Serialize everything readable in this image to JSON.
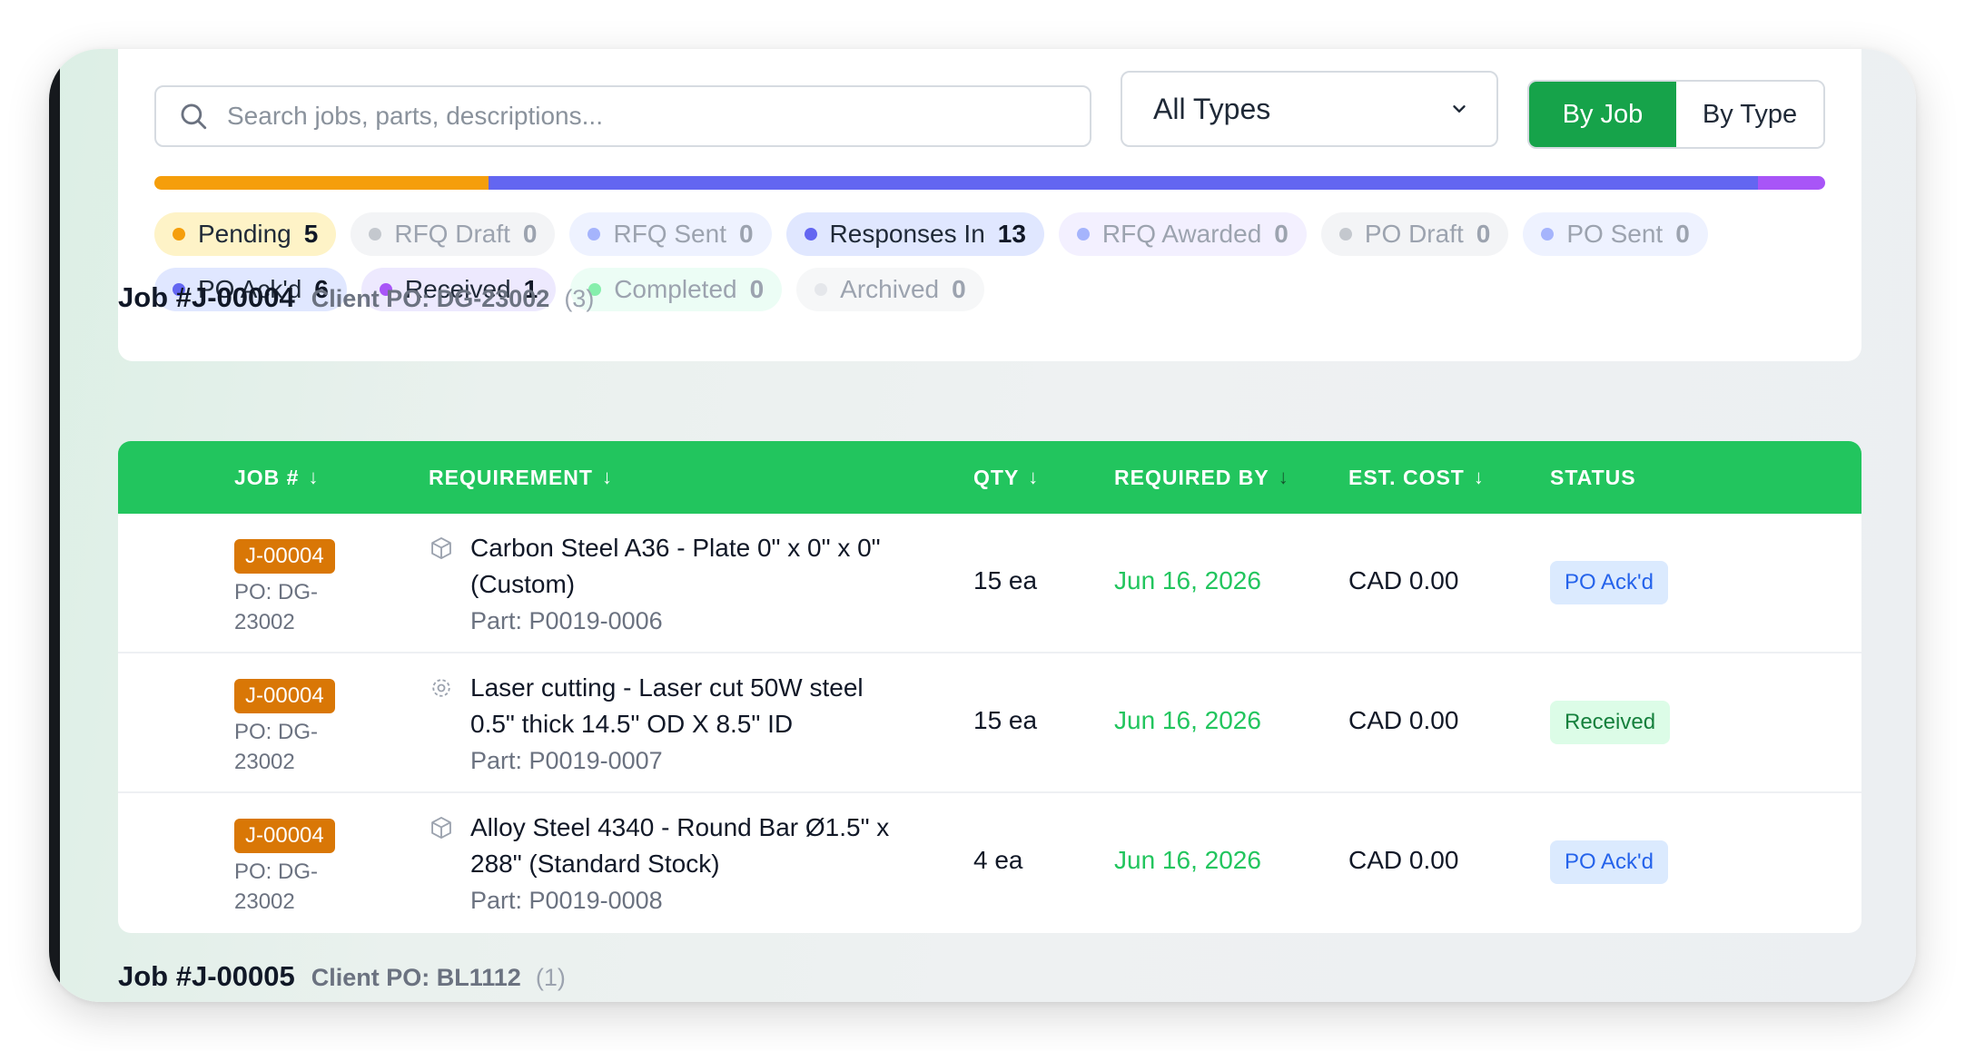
{
  "search": {
    "placeholder": "Search jobs, parts, descriptions..."
  },
  "type_filter": {
    "selected": "All Types"
  },
  "view_toggle": {
    "by_job": "By Job",
    "by_type": "By Type",
    "active": "By Job"
  },
  "progress_segments": [
    {
      "status": "Pending",
      "share": 0.2,
      "color": "#f59e0b"
    },
    {
      "status": "Responses In",
      "share": 0.76,
      "color": "#6366f1"
    },
    {
      "status": "Received",
      "share": 0.04,
      "color": "#a855f7"
    }
  ],
  "status_chips": [
    {
      "label": "Pending",
      "count": "5",
      "bg": "#fef3c7",
      "dot": "#f59e0b",
      "text": "#1f2937"
    },
    {
      "label": "RFQ Draft",
      "count": "0",
      "bg": "#f3f4f6",
      "dot": "#c4c8ce",
      "text": "#9ca3af"
    },
    {
      "label": "RFQ Sent",
      "count": "0",
      "bg": "#eef2ff",
      "dot": "#a5b4fc",
      "text": "#9ca3af"
    },
    {
      "label": "Responses In",
      "count": "13",
      "bg": "#e0e7ff",
      "dot": "#6366f1",
      "text": "#1f2937"
    },
    {
      "label": "RFQ Awarded",
      "count": "0",
      "bg": "#f3f0ff",
      "dot": "#a5b4fc",
      "text": "#9ca3af"
    },
    {
      "label": "PO Draft",
      "count": "0",
      "bg": "#f3f4f6",
      "dot": "#c4c8ce",
      "text": "#9ca3af"
    },
    {
      "label": "PO Sent",
      "count": "0",
      "bg": "#eef2ff",
      "dot": "#a5b4fc",
      "text": "#9ca3af"
    },
    {
      "label": "PO Ack'd",
      "count": "6",
      "bg": "#e0e7ff",
      "dot": "#6366f1",
      "text": "#1f2937"
    },
    {
      "label": "Received",
      "count": "1",
      "bg": "#ede9fe",
      "dot": "#a855f7",
      "text": "#1f2937"
    },
    {
      "label": "Completed",
      "count": "0",
      "bg": "#ecfdf5",
      "dot": "#86efac",
      "text": "#9ca3af"
    },
    {
      "label": "Archived",
      "count": "0",
      "bg": "#f6f7f8",
      "dot": "#e5e7eb",
      "text": "#9ca3af"
    }
  ],
  "jobs": [
    {
      "title": "Job #J-00004",
      "client_po": "Client PO: DG-23002",
      "count": "(3)"
    },
    {
      "title": "Job #J-00005",
      "client_po": "Client PO: BL1112",
      "count": "(1)"
    }
  ],
  "table": {
    "columns": [
      {
        "label": "JOB #",
        "sortable": true
      },
      {
        "label": "REQUIREMENT",
        "sortable": true
      },
      {
        "label": "QTY",
        "sortable": true
      },
      {
        "label": "REQUIRED BY",
        "sortable": true
      },
      {
        "label": "EST. COST",
        "sortable": true
      },
      {
        "label": "STATUS",
        "sortable": false
      }
    ],
    "rows": [
      {
        "job": "J-00004",
        "po_line1": "PO: DG-",
        "po_line2": "23002",
        "icon": "box-icon",
        "req_line1": "Carbon Steel A36 - Plate 0\" x 0\" x 0\"",
        "req_line2": "(Custom)",
        "part": "Part: P0019-0006",
        "qty": "15 ea",
        "required_by": "Jun 16, 2026",
        "cost": "CAD 0.00",
        "status": "PO Ack'd"
      },
      {
        "job": "J-00004",
        "po_line1": "PO: DG-",
        "po_line2": "23002",
        "icon": "gear-icon",
        "req_line1": "Laser cutting - Laser cut 50W steel",
        "req_line2": "0.5\" thick 14.5\" OD X 8.5\" ID",
        "part": "Part: P0019-0007",
        "qty": "15 ea",
        "required_by": "Jun 16, 2026",
        "cost": "CAD 0.00",
        "status": "Received"
      },
      {
        "job": "J-00004",
        "po_line1": "PO: DG-",
        "po_line2": "23002",
        "icon": "box-icon",
        "req_line1": "Alloy Steel 4340 - Round Bar Ø1.5\" x",
        "req_line2": "288\" (Standard Stock)",
        "part": "Part: P0019-0008",
        "qty": "4 ea",
        "required_by": "Jun 16, 2026",
        "cost": "CAD 0.00",
        "status": "PO Ack'd"
      }
    ]
  }
}
